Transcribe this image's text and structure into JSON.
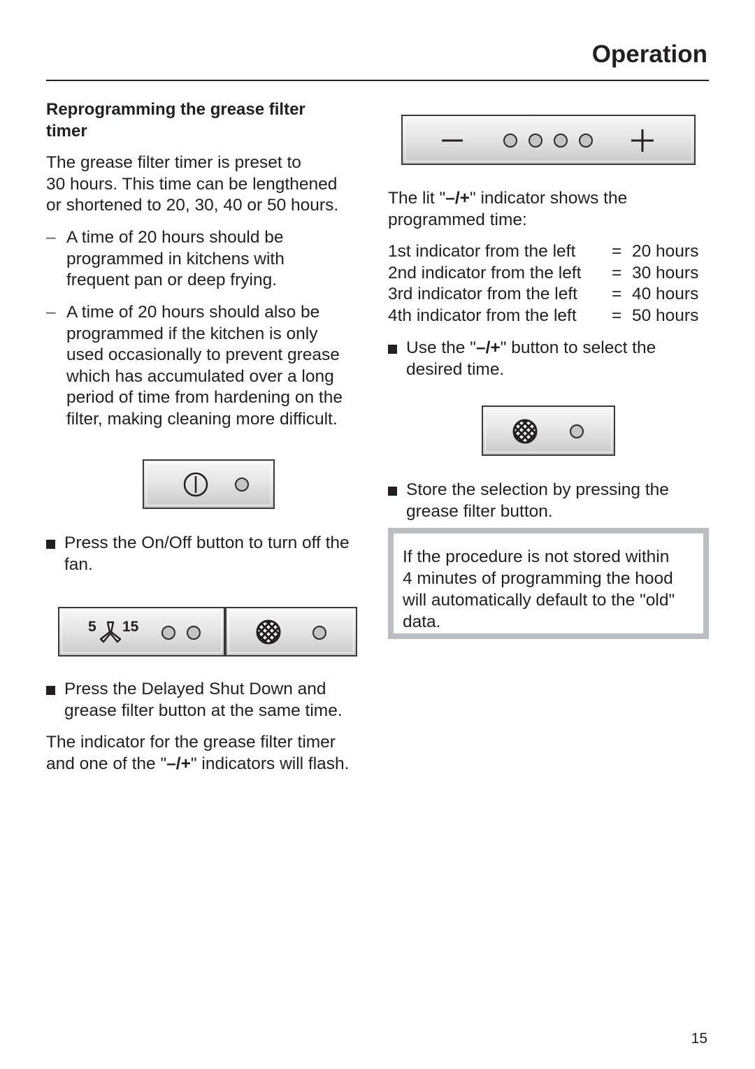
{
  "header": {
    "title": "Operation"
  },
  "left": {
    "heading": [
      "Reprogramming the grease filter",
      "timer"
    ],
    "intro": [
      "The grease filter timer is preset to",
      "30 hours. This time can be lengthened",
      "or shortened to 20, 30, 40 or 50 hours."
    ],
    "dash_items": [
      {
        "marker": "–",
        "lines": [
          "A time of 20 hours should be",
          "programmed in kitchens with",
          "frequent pan or deep frying."
        ]
      },
      {
        "marker": "–",
        "lines": [
          "A time of 20 hours should also be",
          "programmed if the kitchen is only",
          "used occasionally to prevent grease",
          "which has accumulated over a long",
          "period of time from hardening on the",
          "filter, making cleaning more difficult."
        ]
      }
    ],
    "step_onoff": [
      "Press the On/Off button to turn off the",
      "fan."
    ],
    "step_delayed": [
      "Press the Delayed Shut Down and",
      "grease filter button at the same time."
    ],
    "flash_text": {
      "line1": "The indicator for the grease filter timer",
      "line2_pre": "and one of the \"",
      "line2_bold": "–/+",
      "line2_post": "\" indicators will flash."
    },
    "delayed_panel": {
      "num_left": "5",
      "num_right": "15",
      "icon": "fan-icon"
    }
  },
  "right": {
    "lit_text": {
      "pre": "The lit \"",
      "bold": "–/+",
      "post": "\" indicator shows the",
      "line2": "programmed time:"
    },
    "indicator_table": [
      {
        "label": "1st indicator from the left",
        "eq": "=",
        "value": "20 hours"
      },
      {
        "label": "2nd indicator from the left",
        "eq": "=",
        "value": "30 hours"
      },
      {
        "label": "3rd indicator from the left",
        "eq": "=",
        "value": "40 hours"
      },
      {
        "label": "4th indicator from the left",
        "eq": "=",
        "value": "50 hours"
      }
    ],
    "step_select": {
      "pre": "Use the \"",
      "bold": "–/+",
      "post": "\" button to select the",
      "line2": "desired time."
    },
    "step_store": [
      "Store the selection by pressing the",
      "grease filter button."
    ],
    "note": [
      "If the procedure is not stored within",
      "4 minutes of programming the hood",
      "will automatically default to the \"old\"",
      "data."
    ],
    "minus_plus_panel": {
      "minus": "−",
      "plus": "+",
      "indicator_count": 4
    }
  },
  "footer": {
    "page_number": "15"
  }
}
